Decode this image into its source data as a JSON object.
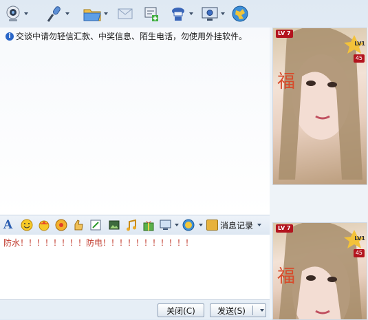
{
  "toolbar": {
    "buttons": [
      {
        "name": "video-call",
        "icon": "webcam-icon",
        "has_dropdown": true
      },
      {
        "name": "voice-call",
        "icon": "microphone-icon",
        "has_dropdown": true
      },
      {
        "name": "send-file",
        "icon": "folder-icon",
        "has_dropdown": true
      },
      {
        "name": "send-sms",
        "icon": "envelope-icon",
        "has_dropdown": false
      },
      {
        "name": "create-discussion",
        "icon": "add-chat-icon",
        "has_dropdown": false
      },
      {
        "name": "remote-assist",
        "icon": "people-icon",
        "has_dropdown": true
      },
      {
        "name": "apps",
        "icon": "monitor-gear-icon",
        "has_dropdown": true
      },
      {
        "name": "qq-space",
        "icon": "globe-icon",
        "has_dropdown": false
      }
    ]
  },
  "chat": {
    "notice": "交谈中请勿轻信汇款、中奖信息、陌生电话，勿使用外挂软件。"
  },
  "input_toolbar": {
    "history_label": "消息记录"
  },
  "input": {
    "text": "防水！！！！！！！！防电！！！！！！！！！！！"
  },
  "bottom": {
    "close_label": "关闭(C)",
    "send_label": "发送(S)"
  },
  "right": {
    "top_video": {
      "level": "LV 7",
      "vol": "45",
      "star_level": "LV1"
    },
    "bottom_video": {
      "level": "LV 7",
      "vol": "45",
      "star_level": "LV1"
    }
  },
  "colors": {
    "accent": "#2a66c8",
    "input_text": "#c0392b",
    "badge": "#b3141e"
  }
}
